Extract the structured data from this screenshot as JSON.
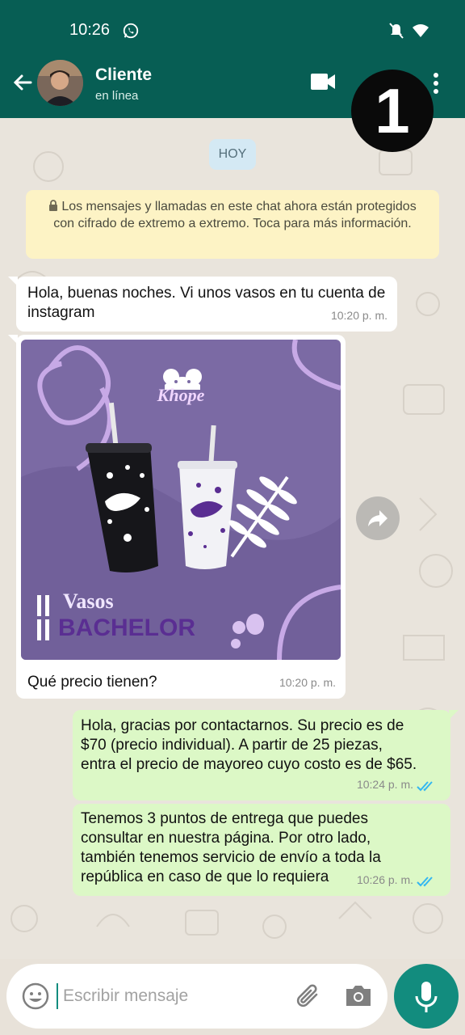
{
  "status_bar": {
    "time": "10:26"
  },
  "header": {
    "contact_name": "Cliente",
    "contact_status": "en línea",
    "badge_number": "1"
  },
  "chat": {
    "date_label": "HOY",
    "encryption_notice": "Los mensajes y llamadas en este chat ahora están protegidos con cifrado de extremo a extremo. Toca para más información.",
    "messages": [
      {
        "direction": "incoming",
        "text": "Hola, buenas noches. Vi unos vasos en tu cuenta de instagram",
        "time": "10:20 p. m."
      },
      {
        "direction": "incoming",
        "type": "image",
        "image_text": {
          "brand": "Khope",
          "line1": "Vasos",
          "line2": "BACHELOR"
        },
        "caption": "Qué precio tienen?",
        "time": "10:20 p. m."
      },
      {
        "direction": "outgoing",
        "text": "Hola, gracias por contactarnos. Su precio es de $70 (precio individual). A partir de 25 piezas, entra el precio de mayoreo cuyo costo es de $65.",
        "time": "10:24 p. m.",
        "status": "read"
      },
      {
        "direction": "outgoing",
        "text": "Tenemos 3 puntos de entrega que puedes consultar en nuestra página. Por otro lado, también tenemos servicio de envío a toda la república en caso de que lo requiera",
        "time": "10:26 p. m.",
        "status": "read"
      }
    ]
  },
  "input": {
    "placeholder": "Escribir mensaje"
  },
  "icons": {
    "back": "arrow-left-icon",
    "video": "video-camera-icon",
    "menu": "more-vert-icon",
    "forward": "forward-icon",
    "emoji": "emoji-icon",
    "attach": "paperclip-icon",
    "camera": "camera-icon",
    "mic": "microphone-icon",
    "read_receipt": "double-check-icon"
  },
  "colors": {
    "header": "#075e54",
    "outgoing_bubble": "#dcf8c6",
    "incoming_bubble": "#ffffff",
    "read_check": "#34b7f1",
    "accent": "#128c7e",
    "notice": "#fdf3c5"
  }
}
